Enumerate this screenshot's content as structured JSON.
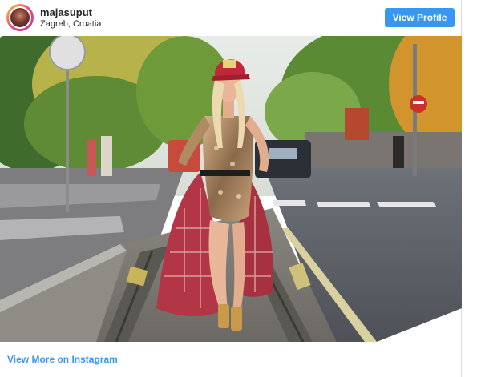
{
  "post": {
    "username": "majasuput",
    "location": "Zagreb, Croatia",
    "view_profile_label": "View Profile",
    "view_more_label": "View More on Instagram"
  },
  "colors": {
    "button_blue": "#3897f0",
    "link_blue": "#3897f0",
    "text_dark": "#262626"
  },
  "icons": {
    "avatar": "profile-avatar"
  }
}
